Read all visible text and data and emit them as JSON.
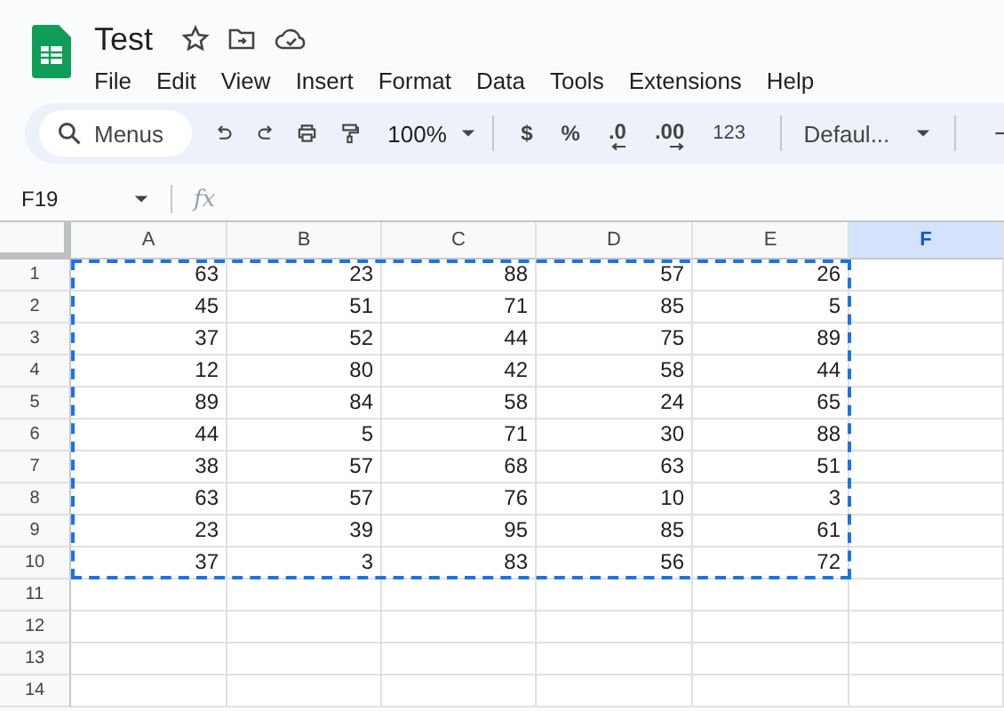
{
  "document": {
    "title": "Test"
  },
  "menu": [
    "File",
    "Edit",
    "View",
    "Insert",
    "Format",
    "Data",
    "Tools",
    "Extensions",
    "Help"
  ],
  "toolbar": {
    "search": {
      "placeholder": "Menus"
    },
    "zoom": "100%",
    "currency": "$",
    "percent": "%",
    "decrease_decimal": ".0",
    "increase_decimal": ".00",
    "number_format": "123",
    "font": "Defaul..."
  },
  "formula_bar": {
    "name_box": "F19",
    "fx": "fx"
  },
  "columns": [
    {
      "label": "A",
      "selected": false
    },
    {
      "label": "B",
      "selected": false
    },
    {
      "label": "C",
      "selected": false
    },
    {
      "label": "D",
      "selected": false
    },
    {
      "label": "E",
      "selected": false
    },
    {
      "label": "F",
      "selected": true
    }
  ],
  "rows": [
    {
      "label": "1",
      "cells": [
        "63",
        "23",
        "88",
        "57",
        "26"
      ]
    },
    {
      "label": "2",
      "cells": [
        "45",
        "51",
        "71",
        "85",
        "5"
      ]
    },
    {
      "label": "3",
      "cells": [
        "37",
        "52",
        "44",
        "75",
        "89"
      ]
    },
    {
      "label": "4",
      "cells": [
        "12",
        "80",
        "42",
        "58",
        "44"
      ]
    },
    {
      "label": "5",
      "cells": [
        "89",
        "84",
        "58",
        "24",
        "65"
      ]
    },
    {
      "label": "6",
      "cells": [
        "44",
        "5",
        "71",
        "30",
        "88"
      ]
    },
    {
      "label": "7",
      "cells": [
        "38",
        "57",
        "68",
        "63",
        "51"
      ]
    },
    {
      "label": "8",
      "cells": [
        "63",
        "57",
        "76",
        "10",
        "3"
      ]
    },
    {
      "label": "9",
      "cells": [
        "23",
        "39",
        "95",
        "85",
        "61"
      ]
    },
    {
      "label": "10",
      "cells": [
        "37",
        "3",
        "83",
        "56",
        "72"
      ]
    },
    {
      "label": "11",
      "cells": []
    },
    {
      "label": "12",
      "cells": []
    },
    {
      "label": "13",
      "cells": []
    },
    {
      "label": "14",
      "cells": []
    }
  ]
}
